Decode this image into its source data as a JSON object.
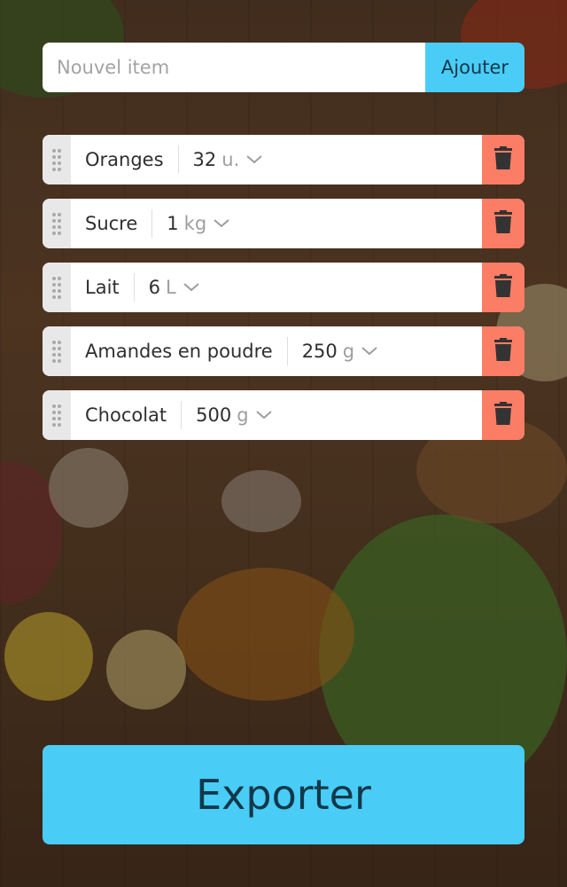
{
  "add_form": {
    "input_placeholder": "Nouvel item",
    "input_value": "",
    "add_label": "Ajouter"
  },
  "items": [
    {
      "name": "Oranges",
      "quantity": "32",
      "unit": "u."
    },
    {
      "name": "Sucre",
      "quantity": "1",
      "unit": "kg"
    },
    {
      "name": "Lait",
      "quantity": "6",
      "unit": "L"
    },
    {
      "name": "Amandes en poudre",
      "quantity": "250",
      "unit": "g"
    },
    {
      "name": "Chocolat",
      "quantity": "500",
      "unit": "g"
    }
  ],
  "export_label": "Exporter",
  "icons": {
    "drag": "drag-handle-icon",
    "dropdown": "chevron-down-icon",
    "delete": "trash-icon"
  },
  "colors": {
    "accent": "#49cdf7",
    "delete": "#fb7d66",
    "handle": "#e8e8e8"
  }
}
